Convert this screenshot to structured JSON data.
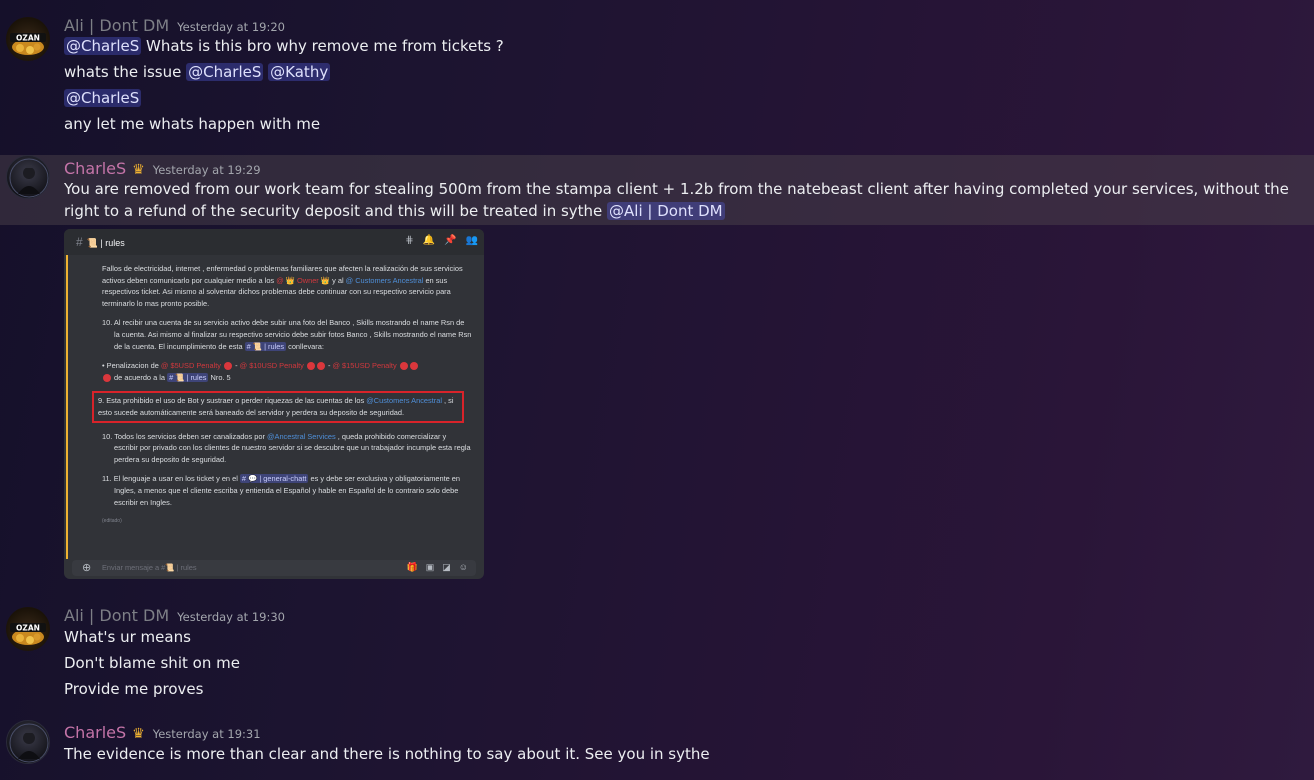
{
  "messages": [
    {
      "author": "Ali | Dont DM",
      "timestamp": "Yesterday at 19:20",
      "avatar_label": "OZAN",
      "lines": [
        {
          "mention1": "@CharleS",
          "text": " Whats is this bro why remove me from tickets ?"
        },
        {
          "text": "whats the issue ",
          "mention1": "@CharleS",
          "mention2": "@Kathy"
        },
        {
          "mention1": "@CharleS"
        },
        {
          "text": "any let me whats happen with me"
        }
      ]
    },
    {
      "author": "CharleS",
      "badge": "crown-icon",
      "timestamp": "Yesterday at 19:29",
      "text": "You are removed from our work team for stealing 500m from the stampa client + 1.2b from the natebeast client after having completed your services, without the right to a refund of the security deposit and this will be treated in sythe ",
      "mention": "@Ali | Dont DM",
      "attachment": {
        "channel": "📜 | rules",
        "p1": "Fallos de electricidad, internet , enfermedad o problemas familiares que afecten la realización de sus servicios activos deben comunicarlo por cualquier medio a los ",
        "p1_owner": "@ 👑 Owner 👑",
        "p1_mid": " y al ",
        "p1_customers": "@ Customers Ancestral",
        "p1_end": " en sus respectivos ticket. Asi mismo al solventar dichos problemas debe continuar con su respectivo servicio para terminarlo lo mas pronto posible.",
        "p10a": "10. Al recibir una cuenta de su servicio activo debe subir una foto del Banco , Skills mostrando el name Rsn de la cuenta. Asi mismo al finalizar su respectivo servicio debe subir fotos Banco , Skills mostrando el name Rsn de la cuenta. El incumplimiento de esta ",
        "p10a_chip": "# 📜 | rules",
        "p10a_end": " conllevara:",
        "penal_label": "Penalizacion de ",
        "penal_1": "@ $5USD Penalty",
        "penal_2": "@ $10USD Penalty",
        "penal_3": "@ $15USD Penalty",
        "penal_end_a": " de acuerdo a la ",
        "penal_chip": "# 📜 | rules",
        "penal_end_b": " Nro. 5",
        "p9a": "9. Esta prohibido el uso de Bot y sustraer o perder riquezas de las cuentas de los ",
        "p9_customers": "@Customers Ancestral",
        "p9b": " , si esto sucede automáticamente será baneado del servidor y perdera su deposito de seguridad.",
        "p10b_a": "10. Todos los servicios deben ser canalizados por ",
        "p10b_mention": "@Ancestral Services",
        "p10b_b": " , queda prohibido comercializar y escribir por privado con los clientes de nuestro servidor si se descubre que un trabajador incumple esta regla perdera su deposito de seguridad.",
        "p11a": "11. El lenguaje a usar en los ticket y en el ",
        "p11_chip": "# 💬 | general-chatt",
        "p11b": " es y debe ser exclusiva y obligatoriamente en Ingles, a menos que el cliente escriba y entienda el Español y hable en Español de lo contrario solo debe escribir en Ingles.",
        "edited": "(editado)",
        "input_placeholder": "Enviar mensaje a #📜 | rules"
      }
    },
    {
      "author": "Ali | Dont DM",
      "timestamp": "Yesterday at 19:30",
      "avatar_label": "OZAN",
      "lines": [
        {
          "text": "What's ur means"
        },
        {
          "text": "Don't blame shit on me"
        },
        {
          "text": "Provide me proves"
        }
      ]
    },
    {
      "author": "CharleS",
      "badge": "crown-icon",
      "timestamp": "Yesterday at 19:31",
      "text": "The evidence is more than clear and there is nothing to say about it. See you in sythe"
    }
  ],
  "colors": {
    "mention_bg": "#3b3f7a",
    "ali_name": "#7d7f86",
    "charles_name": "#c474a8",
    "crown": "#f0b232"
  }
}
